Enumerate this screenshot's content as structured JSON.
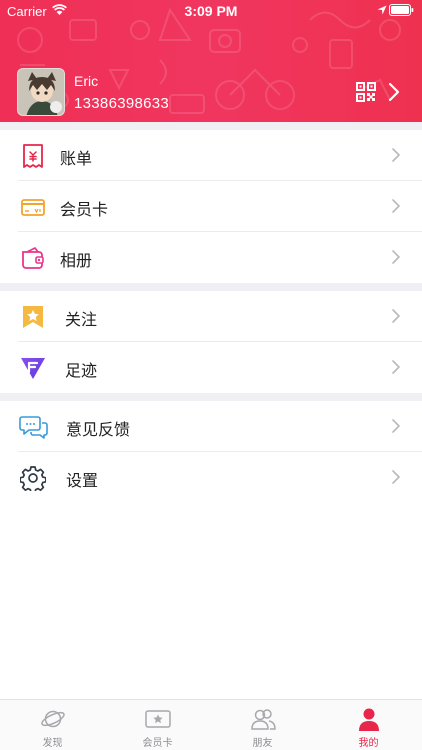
{
  "status_bar": {
    "carrier": "Carrier",
    "time": "3:09 PM"
  },
  "profile": {
    "name": "Eric",
    "phone": "13386398633"
  },
  "menu_groups": [
    {
      "items": [
        {
          "label": "账单",
          "icon": "bill-icon"
        },
        {
          "label": "会员卡",
          "icon": "membership-card-icon"
        },
        {
          "label": "相册",
          "icon": "album-icon"
        }
      ]
    },
    {
      "items": [
        {
          "label": "关注",
          "icon": "bookmark-star-icon"
        },
        {
          "label": "足迹",
          "icon": "footprint-icon"
        }
      ]
    },
    {
      "items": [
        {
          "label": "意见反馈",
          "icon": "feedback-chat-icon"
        },
        {
          "label": "设置",
          "icon": "settings-gear-icon"
        }
      ]
    }
  ],
  "tabbar": {
    "tabs": [
      {
        "label": "发现",
        "icon": "planet-icon",
        "active": false
      },
      {
        "label": "会员卡",
        "icon": "star-card-icon",
        "active": false
      },
      {
        "label": "朋友",
        "icon": "friends-icon",
        "active": false
      },
      {
        "label": "我的",
        "icon": "person-icon",
        "active": true
      }
    ]
  },
  "colors": {
    "brand": "#ef2f55",
    "tab_active": "#e8264b",
    "tab_inactive": "#8e8e93",
    "background_gap": "#efeff4"
  }
}
